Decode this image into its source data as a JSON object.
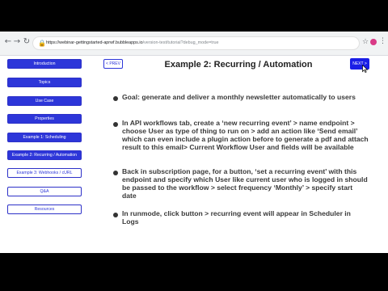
{
  "browser": {
    "url_host": "https://webinar-gettingstarted-aprwf.bubbleapps.io",
    "url_path": "/version-test/tutorial?debug_mode=true",
    "back_icon": "back-arrow-icon",
    "forward_icon": "forward-arrow-icon",
    "reload_icon": "reload-icon",
    "lock_icon": "lock-icon",
    "star_icon": "star-icon",
    "menu_icon": "kebab-menu-icon"
  },
  "sidebar": {
    "items": [
      {
        "label": "Introduction",
        "style": "filled"
      },
      {
        "label": "Topics",
        "style": "filled"
      },
      {
        "label": "Use Case",
        "style": "filled"
      },
      {
        "label": "Properties",
        "style": "filled"
      },
      {
        "label": "Example 1: Scheduling",
        "style": "filled"
      },
      {
        "label": "Example 2: Recurring / Automation",
        "style": "filled"
      },
      {
        "label": "Example 3: Webhooks / cURL",
        "style": "outline"
      },
      {
        "label": "Q&A",
        "style": "outline"
      },
      {
        "label": "Resources",
        "style": "outline"
      }
    ]
  },
  "nav": {
    "prev_label": "< PREV",
    "next_label": "NEXT >"
  },
  "main": {
    "title": "Example 2: Recurring / Automation",
    "bullets": [
      "Goal: generate and deliver a monthly newsletter automatically to users",
      "In API workflows tab, create a ‘new recurring event’ > name endpoint > choose User as type of thing to run on > add an action like ‘Send email’ which can even include a plugin action before to generate a pdf and attach result to this email> Current Workflow User and fields will be available",
      "Back in subscription page, for a button, ‘set a recurring event’ with this endpoint and specify which User like current user who is logged in should be passed to the workflow > select frequency ‘Monthly’ > specify start date",
      "In runmode, click button > recurring event will appear in Scheduler in Logs"
    ]
  },
  "colors": {
    "accent": "#2d36d9",
    "next_button": "#1a1ee6",
    "text": "#3a3a3a"
  }
}
